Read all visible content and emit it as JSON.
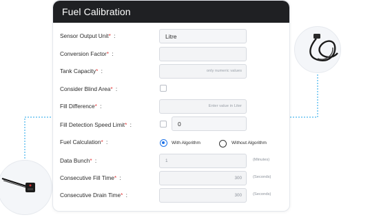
{
  "title": "Fuel Calibration",
  "required_marker": "*",
  "fields": {
    "sensor_output_unit": {
      "label": "Sensor Output Unit",
      "value": "Litre"
    },
    "conversion_factor": {
      "label": "Conversion Factor",
      "value": ""
    },
    "tank_capacity": {
      "label": "Tank Capacity",
      "placeholder": "only numeric values"
    },
    "consider_blind_area": {
      "label": "Consider Blind Area",
      "checked": false
    },
    "fill_difference": {
      "label": "Fill Difference",
      "placeholder": "Enter value in Liter"
    },
    "fill_detection_speed_limit": {
      "label": "Fill Detection Speed Limit",
      "checked": false,
      "value": "0"
    },
    "fuel_calculation": {
      "label": "Fuel Calculation",
      "options": [
        "With Algorithm",
        "Without Algorithm"
      ],
      "selected": "With Algorithm"
    },
    "data_bunch": {
      "label": "Data Bunch",
      "value": "1",
      "unit": "(Minutes)"
    },
    "consecutive_fill_time": {
      "label": "Consecutive Fill Time",
      "value": "300",
      "unit": "(Seconds)"
    },
    "consecutive_drain_time": {
      "label": "Consecutive Drain Time",
      "value": "300",
      "unit": "(Seconds)"
    }
  },
  "colors": {
    "header_bg": "#1f2023",
    "required": "#e23b3b",
    "accent": "#1e73e8",
    "connector": "#1aa3e8"
  },
  "icons": {
    "left_device": "fuel-sensor-probe-icon",
    "right_device": "sensor-cable-icon"
  }
}
